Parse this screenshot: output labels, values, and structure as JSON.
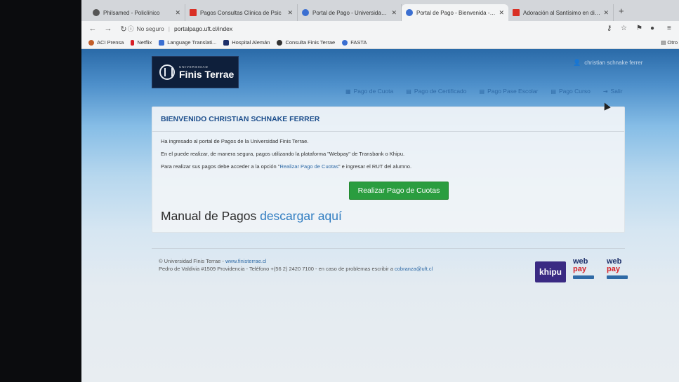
{
  "tabs": [
    {
      "title": "Philsamed - Policlínico",
      "fav_color": "#555555"
    },
    {
      "title": "Pagos Consultas Clínica de Psic",
      "fav_color": "#d93025"
    },
    {
      "title": "Portal de Pago - Universidad Fini",
      "fav_color": "#3b6fd1"
    },
    {
      "title": "Portal de Pago - Bienvenida - Un",
      "fav_color": "#3b6fd1"
    },
    {
      "title": "Adoración al Santísimo en direct",
      "fav_color": "#d93025"
    }
  ],
  "browser": {
    "security_label": "No seguro",
    "url": "portalpago.uft.cl/index",
    "new_tab": "+"
  },
  "bookmarks": [
    {
      "label": "ACI Prensa",
      "color": "#c25e2a"
    },
    {
      "label": "Netflix",
      "color": "#d81f26"
    },
    {
      "label": "Language Translati...",
      "color": "#3b6fd1"
    },
    {
      "label": "Hospital Alemán",
      "color": "#1d2f6a"
    },
    {
      "label": "Consulta Finis Terrae",
      "color": "#333333"
    },
    {
      "label": "FASTA",
      "color": "#3b6fd1"
    }
  ],
  "bookmarks_other": "Otro",
  "site": {
    "logo_small": "UNIVERSIDAD",
    "logo_big": "Finis Terrae",
    "user_name": "christian schnake ferrer",
    "nav": [
      {
        "label": "Pago de Cuota",
        "icon": "table-icon"
      },
      {
        "label": "Pago de Certificado",
        "icon": "book-icon"
      },
      {
        "label": "Pago Pase Escolar",
        "icon": "book-icon"
      },
      {
        "label": "Pago Curso",
        "icon": "book-icon"
      },
      {
        "label": "Salir",
        "icon": "logout-icon"
      }
    ]
  },
  "panel": {
    "heading": "BIENVENIDO CHRISTIAN SCHNAKE FERRER",
    "line1": "Ha ingresado al portal de Pagos de la Universidad Finis Terrae.",
    "line2": "En el puede realizar, de manera segura, pagos utilizando la plataforma \"Webpay\" de Transbank o Khipu.",
    "line3_before": "Para realizar sus pagos debe acceder a la opción \"",
    "line3_link": "Realizar Pago de Cuotas",
    "line3_after": "\" e ingresar el RUT del alumno.",
    "button": "Realizar Pago de Cuotas",
    "manual_text": "Manual de Pagos",
    "manual_link": "descargar aquí"
  },
  "footer": {
    "copyright": "© Universidad Finis Terrae - ",
    "site_link": "www.finisterrae.cl",
    "address": "Pedro de Valdivia #1509 Providencia - Teléfono +(56 2) 2420 7100 - en caso de problemas escribir a ",
    "email": "cobranza@uft.cl",
    "khipu": "khipu",
    "webpay_top": "web",
    "webpay_bottom": "pay"
  }
}
